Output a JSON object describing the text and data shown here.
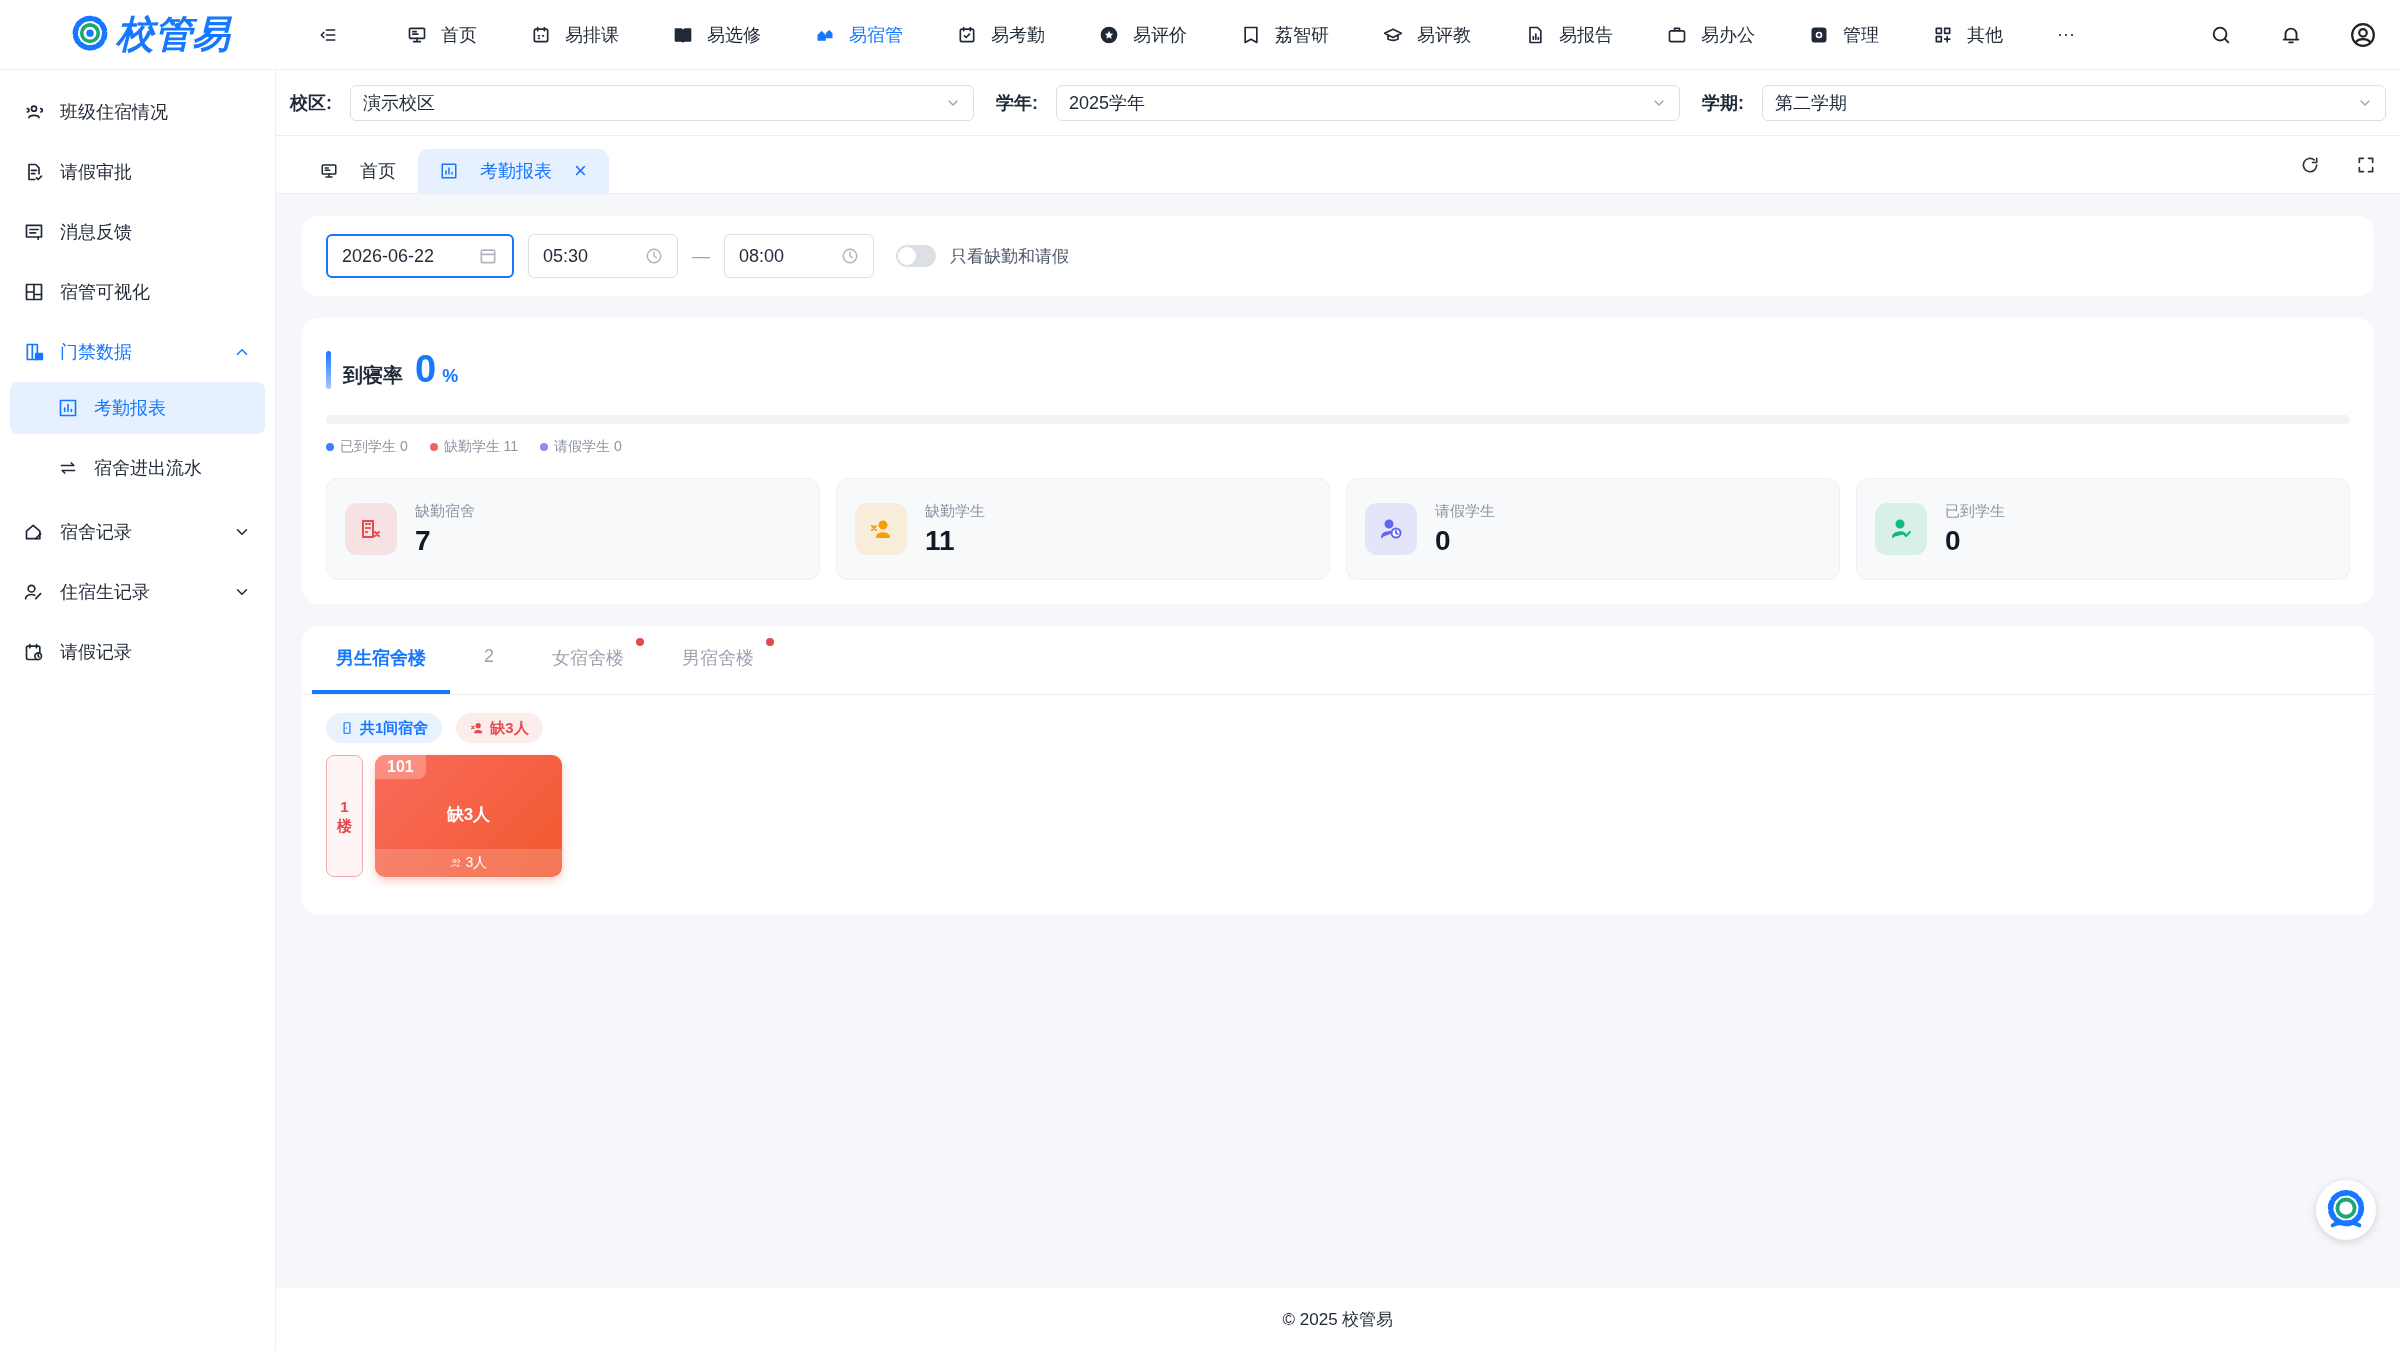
{
  "logo": {
    "text": "校管易"
  },
  "nav": [
    {
      "label": "首页",
      "selected": false
    },
    {
      "label": "易排课",
      "selected": false
    },
    {
      "label": "易选修",
      "selected": false
    },
    {
      "label": "易宿管",
      "selected": true
    },
    {
      "label": "易考勤",
      "selected": false
    },
    {
      "label": "易评价",
      "selected": false
    },
    {
      "label": "荔智研",
      "selected": false
    },
    {
      "label": "易评教",
      "selected": false
    },
    {
      "label": "易报告",
      "selected": false
    },
    {
      "label": "易办公",
      "selected": false
    },
    {
      "label": "管理",
      "selected": false
    },
    {
      "label": "其他",
      "selected": false
    },
    {
      "label": "···",
      "selected": false
    }
  ],
  "sidebar": {
    "items": [
      {
        "label": "班级住宿情况",
        "selected": false
      },
      {
        "label": "请假审批",
        "selected": false
      },
      {
        "label": "消息反馈",
        "selected": false
      },
      {
        "label": "宿管可视化",
        "selected": false
      },
      {
        "label": "门禁数据",
        "selected": false,
        "expanded": true,
        "children": [
          {
            "label": "考勤报表",
            "selected": true
          },
          {
            "label": "宿舍进出流水",
            "selected": false
          }
        ]
      },
      {
        "label": "宿舍记录",
        "selected": false,
        "expanded": false
      },
      {
        "label": "住宿生记录",
        "selected": false,
        "expanded": false
      },
      {
        "label": "请假记录",
        "selected": false
      }
    ]
  },
  "filters": [
    {
      "label": "校区:",
      "value": "演示校区"
    },
    {
      "label": "学年:",
      "value": "2025学年"
    },
    {
      "label": "学期:",
      "value": "第二学期"
    }
  ],
  "page_tabs": [
    {
      "label": "首页",
      "selected": false,
      "closable": false
    },
    {
      "label": "考勤报表",
      "selected": true,
      "closable": true,
      "close": "×"
    }
  ],
  "query": {
    "date": "2026-06-22",
    "start_time": "05:30",
    "separator": "—",
    "end_time": "08:00",
    "toggle": {
      "label": "只看缺勤和请假",
      "on": false
    }
  },
  "rate": {
    "title": "到寝率",
    "value": "0",
    "unit": "%",
    "level": 0,
    "legend": [
      {
        "label": "已到学生 0",
        "color": "#3b82f6"
      },
      {
        "label": "缺勤学生 11",
        "color": "#ef6464"
      },
      {
        "label": "请假学生 0",
        "color": "#8b8cf0"
      }
    ],
    "stats": [
      {
        "label": "缺勤宿舍",
        "value": "7",
        "color": "#e5484d"
      },
      {
        "label": "缺勤学生",
        "value": "11",
        "color": "#f59e0b"
      },
      {
        "label": "请假学生",
        "value": "0",
        "color": "#6366f1"
      },
      {
        "label": "已到学生",
        "value": "0",
        "color": "#10b981"
      }
    ]
  },
  "buildings": {
    "tabs": [
      {
        "label": "男生宿舍楼",
        "selected": true,
        "dot": false
      },
      {
        "label": "2",
        "selected": false,
        "dot": false
      },
      {
        "label": "女宿舍楼",
        "selected": false,
        "dot": true
      },
      {
        "label": "男宿舍楼",
        "selected": false,
        "dot": true
      }
    ],
    "tags": [
      {
        "label": "共1间宿舍",
        "kind": "total"
      },
      {
        "label": "缺3人",
        "kind": "absent"
      }
    ],
    "floors": [
      {
        "label": "1楼",
        "rooms": [
          {
            "number": "101",
            "status": "缺3人",
            "kind": "absent",
            "count": "3人"
          }
        ]
      }
    ]
  },
  "footer": "© 2025 校管易"
}
